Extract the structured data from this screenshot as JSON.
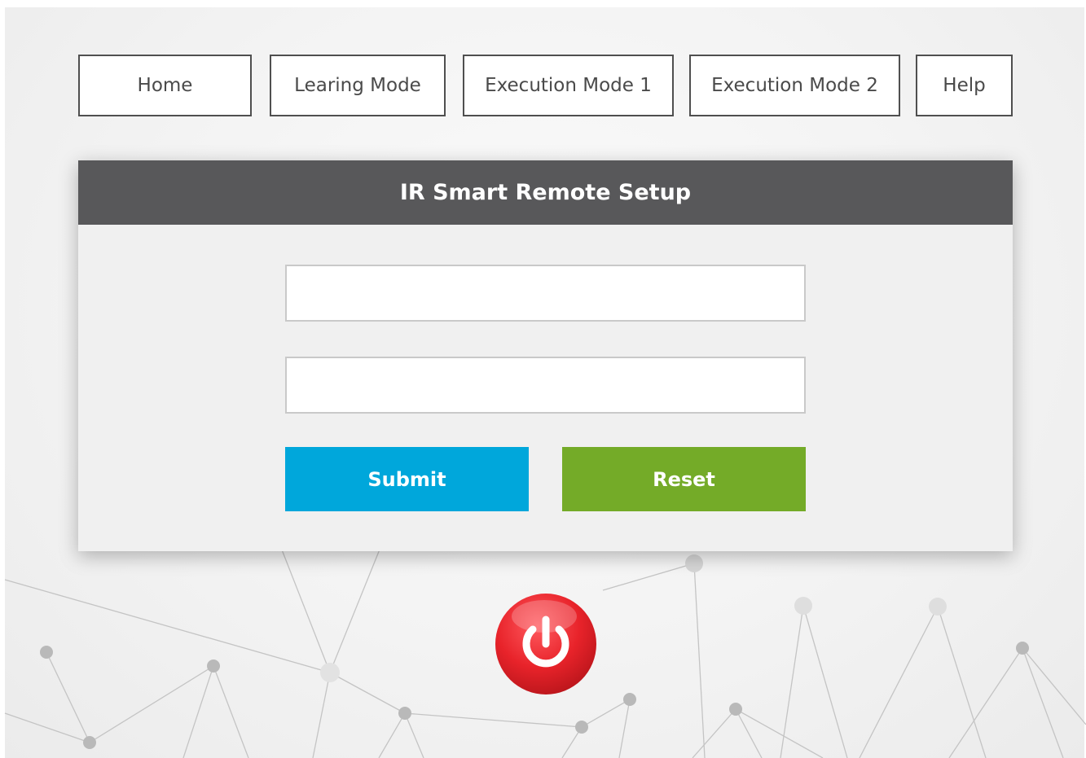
{
  "nav": {
    "items": [
      {
        "label": "Home"
      },
      {
        "label": "Learing Mode"
      },
      {
        "label": "Execution Mode 1"
      },
      {
        "label": "Execution Mode 2"
      },
      {
        "label": "Help"
      }
    ]
  },
  "panel": {
    "title": "IR Smart Remote Setup",
    "fields": [
      {
        "value": "",
        "placeholder": ""
      },
      {
        "value": "",
        "placeholder": ""
      }
    ],
    "submit_label": "Submit",
    "reset_label": "Reset"
  },
  "power": {
    "icon": "power-icon",
    "color": "#e8232a"
  },
  "colors": {
    "header": "#58585a",
    "submit": "#00a7db",
    "reset": "#74ab28",
    "power": "#e8232a"
  }
}
